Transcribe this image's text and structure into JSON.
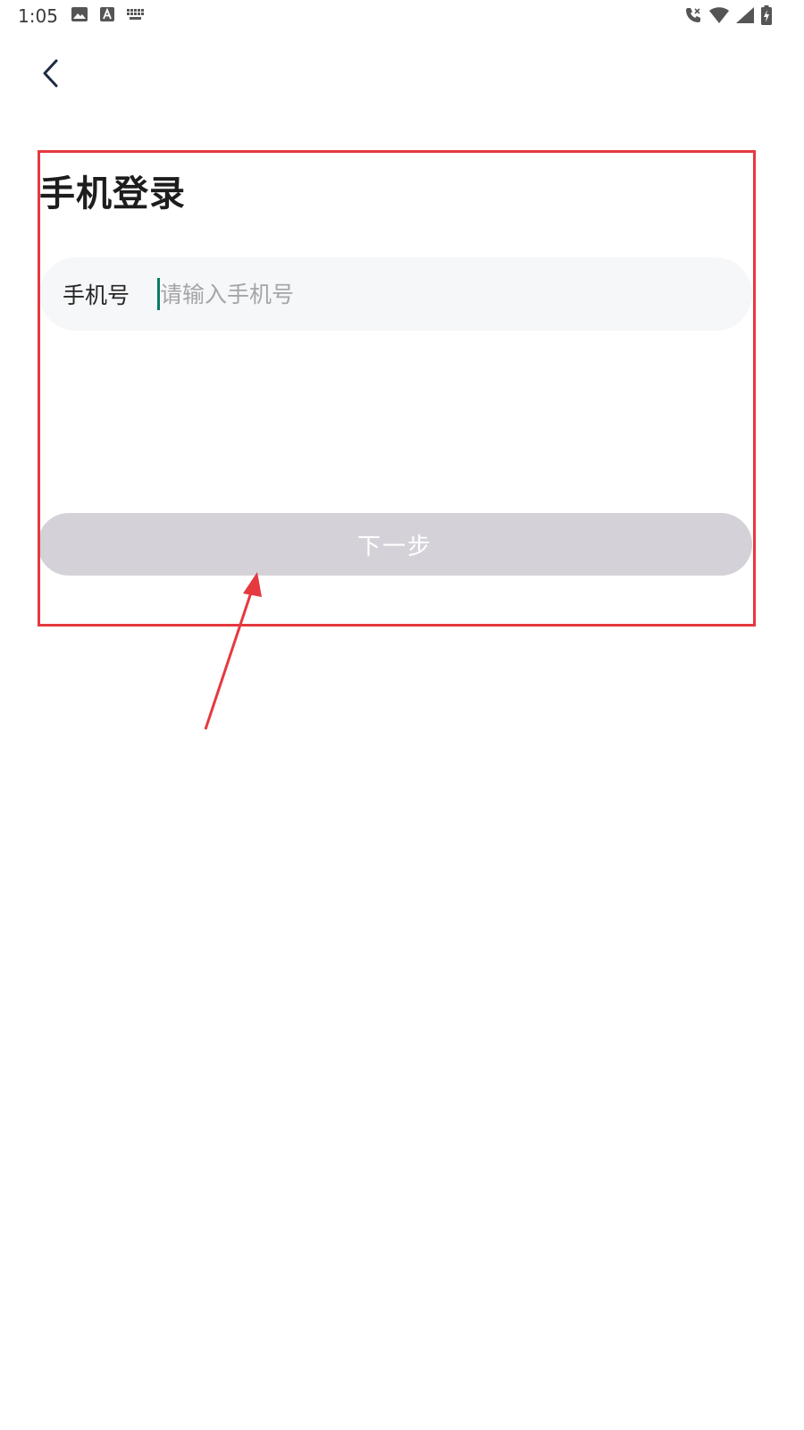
{
  "status_bar": {
    "time": "1:05",
    "left_icons": [
      "image-icon",
      "a-icon",
      "keyboard-icon"
    ],
    "right_icons": [
      "call-icon",
      "wifi-icon",
      "signal-icon",
      "battery-icon"
    ]
  },
  "header": {
    "back_icon": "chevron-left-icon"
  },
  "login": {
    "title": "手机登录",
    "phone_label": "手机号",
    "phone_placeholder": "请输入手机号",
    "phone_value": "",
    "next_label": "下一步"
  },
  "colors": {
    "annotation": "#e5393f",
    "caret": "#0d7a64",
    "button_disabled": "#d4d2d8",
    "field_background": "#f6f7f9"
  }
}
